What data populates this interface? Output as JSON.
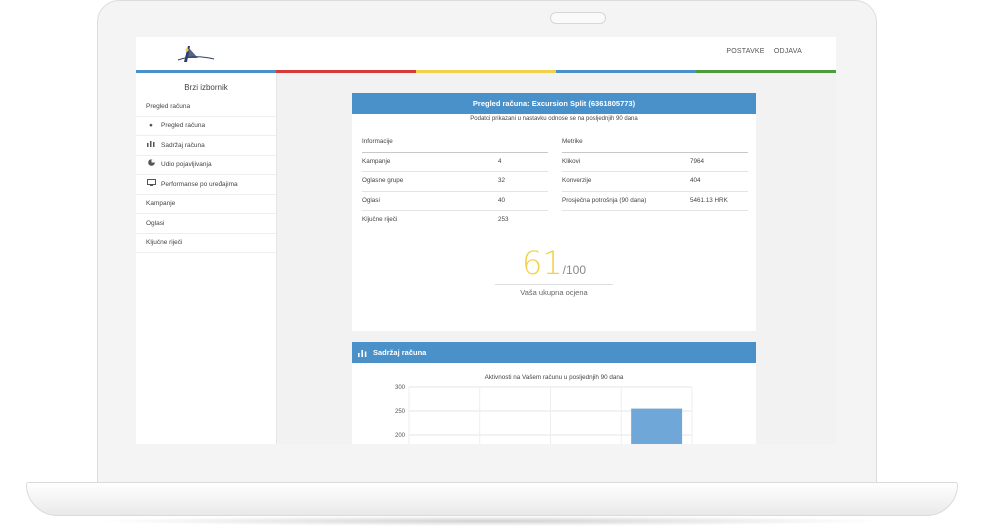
{
  "topnav": {
    "items": [
      "POSTAVKE",
      "ODJAVA"
    ]
  },
  "brand_colors": [
    "#4a90c9",
    "#d63a3a",
    "#f2d24a",
    "#4a90c9",
    "#4e9a3c"
  ],
  "sidebar": {
    "title": "Brzi izbornik",
    "items": [
      {
        "label": "Pregled računa",
        "icon": ""
      },
      {
        "label": "Pregled računa",
        "icon": "user-icon"
      },
      {
        "label": "Sadržaj računa",
        "icon": "bar-chart-icon"
      },
      {
        "label": "Udio pojavljivanja",
        "icon": "pie-chart-icon"
      },
      {
        "label": "Performanse po uređajima",
        "icon": "devices-icon"
      },
      {
        "label": "Kampanje",
        "icon": ""
      },
      {
        "label": "Oglasi",
        "icon": ""
      },
      {
        "label": "Ključne riječi",
        "icon": ""
      }
    ]
  },
  "overview": {
    "title": "Pregled računa: Excursion Split (6361805773)",
    "subtitle": "Podatci prikazani u nastavku odnose se na posljednjih 90 dana",
    "info": {
      "header": "Informacije",
      "rows": [
        {
          "label": "Kampanje",
          "value": "4"
        },
        {
          "label": "Oglasne grupe",
          "value": "32"
        },
        {
          "label": "Oglasi",
          "value": "40"
        },
        {
          "label": "Ključne riječi",
          "value": "253"
        }
      ]
    },
    "metrics": {
      "header": "Metrike",
      "rows": [
        {
          "label": "Klikovi",
          "value": "7964"
        },
        {
          "label": "Konverzije",
          "value": "404"
        },
        {
          "label": "Prosječna potrošnja (90 dana)",
          "value": "5461.13 HRK"
        }
      ]
    },
    "score": {
      "value": "61",
      "max": "/100",
      "label": "Vaša ukupna ocjena"
    }
  },
  "content": {
    "title": "Sadržaj računa",
    "icon": "bar-chart-icon"
  },
  "chart_data": {
    "type": "bar",
    "title": "Aktivnosti na Vašem računu u posljednjih 90 dana",
    "yticks": [
      "300",
      "250",
      "200"
    ],
    "ylim": [
      0,
      300
    ],
    "visible_range": [
      190,
      300
    ],
    "categories_count": 4,
    "values": [
      null,
      null,
      null,
      255
    ],
    "bar_color": "#6fa8d8"
  }
}
